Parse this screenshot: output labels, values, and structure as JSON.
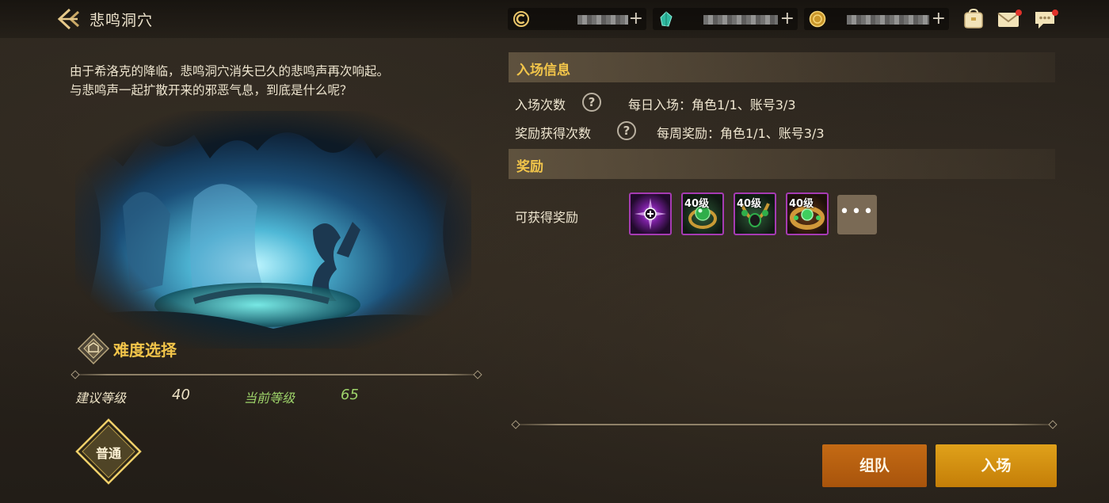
{
  "header": {
    "title": "悲鸣洞穴",
    "back_icon": "back-arrow-icon"
  },
  "currencies": [
    {
      "icon": "coin-c-icon",
      "value_hidden": true
    },
    {
      "icon": "green-gem-icon",
      "value_hidden": true
    },
    {
      "icon": "gold-coin-icon",
      "value_hidden": true
    }
  ],
  "top_icons": [
    {
      "icon": "bag-icon"
    },
    {
      "icon": "mail-icon",
      "notification": true
    },
    {
      "icon": "chat-icon",
      "notification": true
    }
  ],
  "description": {
    "line1": "由于希洛克的降临，悲鸣洞穴消失已久的悲鸣声再次响起。",
    "line2": "与悲鸣声一起扩散开来的邪恶气息，到底是什么呢？"
  },
  "difficulty": {
    "title": "难度选择",
    "recommended_label": "建议等级",
    "recommended_value": "40",
    "current_label": "当前等级",
    "current_value": "65",
    "selected": "普通"
  },
  "entry_info": {
    "header": "入场信息",
    "rows": [
      {
        "label": "入场次数",
        "value": "每日入场：角色1/1、账号3/3"
      },
      {
        "label": "奖励获得次数",
        "value": "每周奖励：角色1/1、账号3/3"
      }
    ]
  },
  "rewards": {
    "header": "奖励",
    "label": "可获得奖励",
    "items": [
      {
        "level": "",
        "icon": "purple-orb-icon"
      },
      {
        "level": "40级",
        "icon": "green-gem-ring-icon"
      },
      {
        "level": "40级",
        "icon": "green-gem-necklace-icon"
      },
      {
        "level": "40级",
        "icon": "gold-green-bracelet-icon"
      }
    ],
    "more_label": "•••"
  },
  "actions": {
    "team_label": "组队",
    "enter_label": "入场"
  },
  "colors": {
    "accent_gold": "#f2c54a",
    "level_green": "#9ed36a",
    "team_button": "#b8620f",
    "enter_button": "#d48e0c"
  }
}
